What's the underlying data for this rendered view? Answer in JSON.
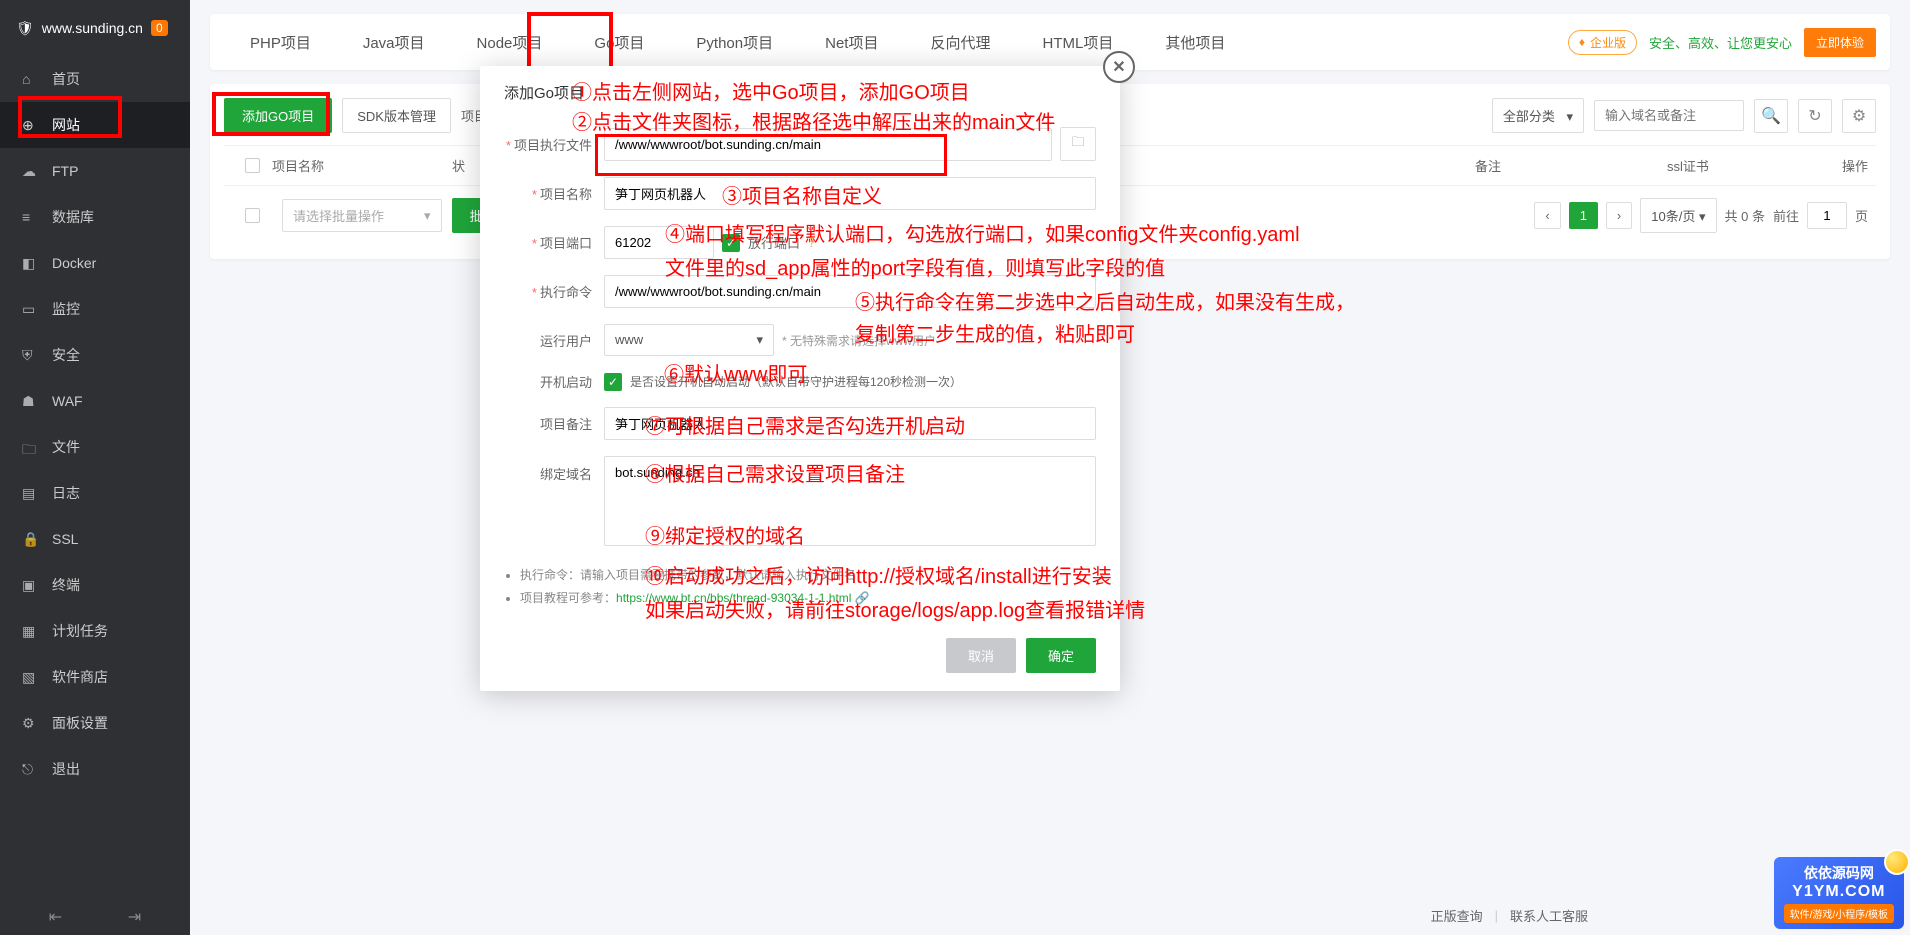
{
  "sidebar": {
    "url": "www.sunding.cn",
    "badge": "0",
    "items": [
      {
        "label": "首页"
      },
      {
        "label": "网站"
      },
      {
        "label": "FTP"
      },
      {
        "label": "数据库"
      },
      {
        "label": "Docker"
      },
      {
        "label": "监控"
      },
      {
        "label": "安全"
      },
      {
        "label": "WAF"
      },
      {
        "label": "文件"
      },
      {
        "label": "日志"
      },
      {
        "label": "SSL"
      },
      {
        "label": "终端"
      },
      {
        "label": "计划任务"
      },
      {
        "label": "软件商店"
      },
      {
        "label": "面板设置"
      },
      {
        "label": "退出"
      }
    ]
  },
  "tabs": [
    "PHP项目",
    "Java项目",
    "Node项目",
    "Go项目",
    "Python项目",
    "Net项目",
    "反向代理",
    "HTML项目",
    "其他项目"
  ],
  "header": {
    "ent_badge": "企业版",
    "slogan": "安全、高效、让您更安心",
    "try_btn": "立即体验"
  },
  "toolbar": {
    "add_btn": "添加GO项目",
    "sdk_btn": "SDK版本管理",
    "notice": "项目",
    "category": "全部分类",
    "search_ph": "输入域名或备注"
  },
  "table": {
    "cols": [
      "项目名称",
      "状",
      "备注",
      "ssl证书",
      "操作"
    ],
    "batch_ph": "请选择批量操作",
    "batch_btn": "批量操作",
    "page_size": "10条/页",
    "total": "共 0 条",
    "goto": "前往",
    "page": "1",
    "page_suffix": "页"
  },
  "modal": {
    "title": "添加Go项目",
    "fields": {
      "exec_file": {
        "label": "项目执行文件",
        "value": "/www/wwwroot/bot.sunding.cn/main"
      },
      "name": {
        "label": "项目名称",
        "value": "笋丁网页机器人"
      },
      "port": {
        "label": "项目端口",
        "value": "61202",
        "checkbox": "放行端口"
      },
      "cmd": {
        "label": "执行命令",
        "value": "/www/wwwroot/bot.sunding.cn/main"
      },
      "user": {
        "label": "运行用户",
        "value": "www",
        "hint": "* 无特殊需求请选择www用户"
      },
      "autostart": {
        "label": "开机启动",
        "text": "是否设置开机自动启动（默认自带守护进程每120秒检测一次）"
      },
      "remark": {
        "label": "项目备注",
        "value": "笋丁网页机器人"
      },
      "domain": {
        "label": "绑定域名",
        "value": "bot.sunding.cn"
      }
    },
    "hints": {
      "cmd": "执行命令：请输入项目需要携带的参数，默认请输入执行文件名",
      "tutorial_prefix": "项目教程可参考：",
      "tutorial_link": "https://www.bt.cn/bbs/thread-93034-1-1.html"
    },
    "cancel": "取消",
    "confirm": "确定"
  },
  "annotations": {
    "a1": "①点击左侧网站，选中Go项目，添加GO项目",
    "a2": "②点击文件夹图标，根据路径选中解压出来的main文件",
    "a3": "③项目名称自定义",
    "a4": "④端口填写程序默认端口，勾选放行端口，如果config文件夹config.yaml",
    "a4b": "文件里的sd_app属性的port字段有值，则填写此字段的值",
    "a5": "⑤执行命令在第二步选中之后自动生成，如果没有生成，",
    "a5b": "复制第二步生成的值，粘贴即可",
    "a6": "⑥默认www即可",
    "a7": "⑦可根据自己需求是否勾选开机启动",
    "a8": "⑧根据自己需求设置项目备注",
    "a9": "⑨绑定授权的域名",
    "a10": "⑩启动成功之后，访问http://授权域名/install进行安装",
    "a10b": "如果启动失败，请前往storage/logs/app.log查看报错详情"
  },
  "footer": {
    "l1": "正版查询",
    "l2": "联系人工客服"
  },
  "watermark": {
    "title": "依依源码网",
    "url": "Y1YM.COM",
    "sub": "软件/游戏/小程序/模板"
  }
}
